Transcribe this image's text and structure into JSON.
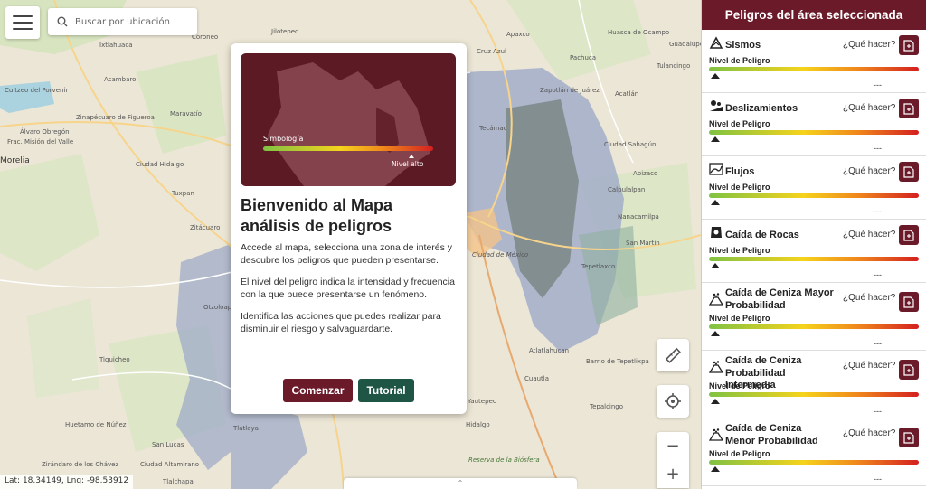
{
  "search": {
    "placeholder": "Buscar por ubicación"
  },
  "map": {
    "places": [
      "Coroneo",
      "Jilotepec",
      "Cruz Azul",
      "Apaxco",
      "Huasca de Ocampo",
      "Guadalupe",
      "Ixtlahuaca",
      "Pachuca",
      "Tulancingo",
      "Acambaro",
      "Zapotlán de Juárez",
      "Acatlán",
      "Cuitzeo del Porvenir",
      "Zinapécuaro de Figueroa",
      "Maravatío",
      "Tecámac",
      "Álvaro Obregón",
      "Frac. Misión del Valle",
      "Ciudad Sahagún",
      "Morelia",
      "Ciudad Hidalgo",
      "Tuxpan",
      "Apizaco",
      "Zitácuaro",
      "Calpulalpan",
      "Nanacamilpa",
      "Ciudad de México",
      "San Martín",
      "Tepetlaxco",
      "Tiquicheo",
      "Cuautla",
      "Atlatlahucan",
      "Barrio de Tepetlixpa",
      "Huetamo de Núñez",
      "Hidalgo",
      "Yautepec",
      "Tepalcingo",
      "Zirándaro de los Chávez",
      "Ciudad Altamirano",
      "San Lucas",
      "Reserva de la Biósfera",
      "Tlalchapa",
      "Tlatlaya",
      "Otzoloapan"
    ]
  },
  "controls": {
    "zoom_out": "−",
    "zoom_in": "+"
  },
  "coords": "Lat: 18.34149, Lng: -98.53912",
  "modal": {
    "legend_title": "Simbología",
    "legend_high": "Nivel alto",
    "title": "Bienvenido al Mapa análisis de peligros",
    "p1": "Accede al mapa, selecciona una zona de interés y descubre los peligros que pueden presentarse.",
    "p2": "El nivel del peligro indica la intensidad y frecuencia con la que puede presentarse un fenómeno.",
    "p3": "Identifica las acciones que puedes realizar para disminuir el riesgo y salvaguardarte.",
    "start_label": "Comenzar",
    "tutorial_label": "Tutorial"
  },
  "sidebar": {
    "title": "Peligros del área seleccionada",
    "level_label": "Nivel de Peligro",
    "what_label": "¿Qué hacer?",
    "hazards": [
      {
        "name": "Sismos",
        "value": "---",
        "icon": "earthquake-icon"
      },
      {
        "name": "Deslizamientos",
        "value": "---",
        "icon": "landslide-icon"
      },
      {
        "name": "Flujos",
        "value": "---",
        "icon": "debris-flow-icon"
      },
      {
        "name": "Caída de Rocas",
        "value": "---",
        "icon": "rockfall-icon"
      },
      {
        "name": "Caída de Ceniza Mayor Probabilidad",
        "value": "---",
        "icon": "ashfall-icon"
      },
      {
        "name": "Caída de Ceniza Probabilidad Intermedia",
        "value": "---",
        "icon": "ashfall-icon"
      },
      {
        "name": "Caída de Ceniza Menor Probabilidad",
        "value": "---",
        "icon": "ashfall-icon"
      }
    ]
  },
  "colors": {
    "brand": "#6b1a2a",
    "secondary": "#1f5545"
  }
}
